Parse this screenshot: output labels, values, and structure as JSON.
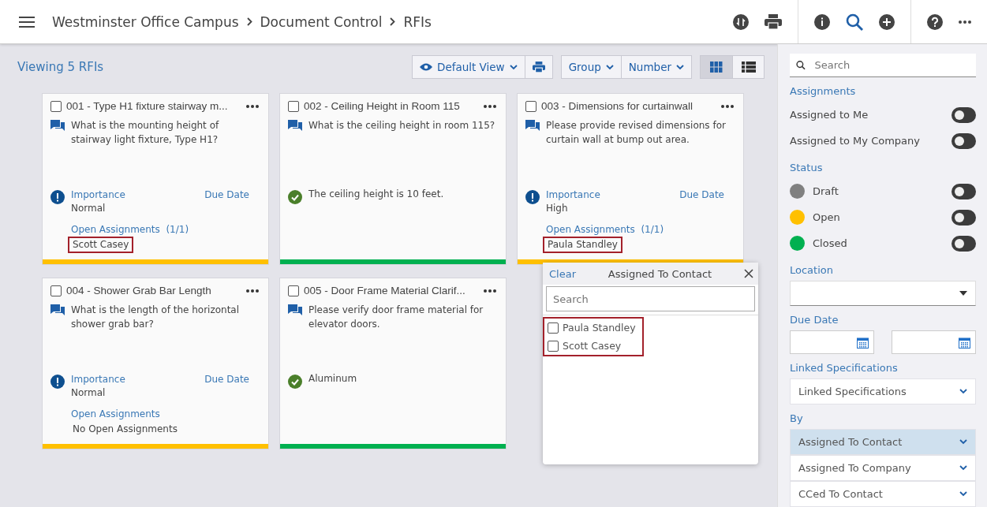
{
  "header": {
    "breadcrumbs": [
      "Westminster Office Campus",
      "Document Control",
      "RFIs"
    ]
  },
  "toolbar": {
    "count_label": "Viewing 5 RFIs",
    "view": "Default View",
    "group": "Group",
    "sort": "Number",
    "layouts": [
      {
        "kind": "grid",
        "selected": true
      },
      {
        "kind": "list",
        "selected": false
      }
    ]
  },
  "cards": [
    {
      "kind": "open",
      "title": "001 - Type H1 fixture stairway m...",
      "checked": false,
      "question": "What is the mounting height of stairway light fixture, Type H1?",
      "importance_label": "Importance",
      "importance": "Normal",
      "due_label": "Due Date",
      "assignments_label": "Open Assignments",
      "assignments_count": "(1/1)",
      "assignee": "Scott Casey",
      "highlighted": true,
      "color": "#ffc000"
    },
    {
      "kind": "answered",
      "title": "002 - Ceiling Height in Room 115",
      "checked": false,
      "question": "What is the ceiling height in room 115?",
      "answer": "The ceiling height is 10 feet.",
      "color": "#00b050"
    },
    {
      "kind": "open",
      "title": "003 - Dimensions for curtainwall",
      "checked": false,
      "question": "Please provide revised dimensions for curtain wall at bump out area.",
      "importance_label": "Importance",
      "importance": "High",
      "due_label": "Due Date",
      "assignments_label": "Open Assignments",
      "assignments_count": "(1/1)",
      "assignee": "Paula Standley",
      "highlighted": true,
      "color": "#ffc000"
    },
    {
      "kind": "open",
      "title": "004 - Shower Grab Bar Length",
      "checked": false,
      "question": "What is the length of the horizontal shower grab bar?",
      "importance_label": "Importance",
      "importance": "Normal",
      "due_label": "Due Date",
      "assignments_label": "Open Assignments",
      "assignee": "No Open Assignments",
      "highlighted": false,
      "color": "#ffc000"
    },
    {
      "kind": "answered",
      "title": "005 - Door Frame Material Clarif...",
      "checked": false,
      "question": "Please verify door frame material for elevator doors.",
      "answer": "Aluminum",
      "color": "#00b050"
    }
  ],
  "popup": {
    "clear": "Clear",
    "title": "Assigned To Contact",
    "search_placeholder": "Search",
    "highlighted": true,
    "options": [
      {
        "label": "Paula Standley",
        "checked": false
      },
      {
        "label": "Scott Casey",
        "checked": false
      }
    ]
  },
  "filters": {
    "search_placeholder": "Search",
    "assignments_label": "Assignments",
    "assignments": [
      {
        "label": "Assigned to Me",
        "on": false
      },
      {
        "label": "Assigned to My Company",
        "on": false
      }
    ],
    "status_label": "Status",
    "statuses": [
      {
        "label": "Draft",
        "color": "#808080",
        "on": false
      },
      {
        "label": "Open",
        "color": "#ffc000",
        "on": false
      },
      {
        "label": "Closed",
        "color": "#00b050",
        "on": false
      }
    ],
    "location_label": "Location",
    "due_date_label": "Due Date",
    "linked_label": "Linked Specifications",
    "linked_value": "Linked Specifications",
    "by_label": "By",
    "by_options": [
      {
        "label": "Assigned To Contact",
        "selected": true
      },
      {
        "label": "Assigned To Company",
        "selected": false
      },
      {
        "label": "CCed To Contact",
        "selected": false
      }
    ]
  }
}
